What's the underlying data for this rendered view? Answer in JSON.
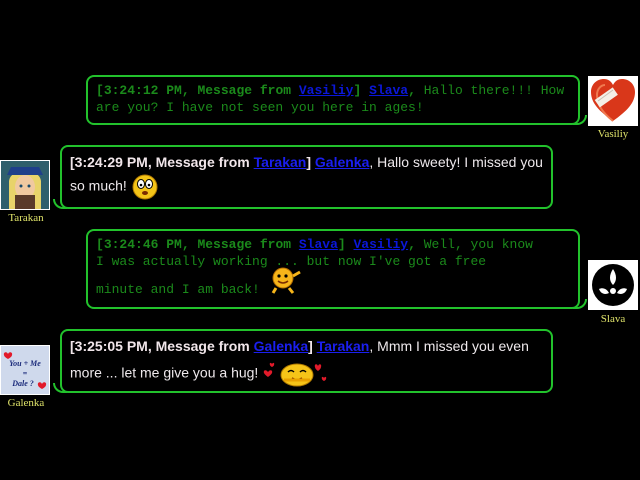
{
  "messages": [
    {
      "time": "3:24:12 PM",
      "prefix": "Message from",
      "from": "Vasiliy",
      "to": "Slava",
      "text": "Hallo there!!! How are you? I have not seen you here in ages!",
      "avatar_name": "Vasiliy"
    },
    {
      "time": "3:24:29 PM",
      "prefix": "Message from",
      "from": "Tarakan",
      "to": "Galenka",
      "text_line1": "Hallo sweety! I missed you",
      "text_line2": "so much!",
      "avatar_name": "Tarakan"
    },
    {
      "time": "3:24:46 PM",
      "prefix": "Message from",
      "from": "Slava",
      "to": "Vasiliy",
      "text_line1": "Well, you know",
      "text_line2": "I was actually working ... but now I've got a free",
      "text_line3": "minute and I am back!",
      "avatar_name": "Slava"
    },
    {
      "time": "3:25:05 PM",
      "prefix": "Message from",
      "from": "Galenka",
      "to": "Tarakan",
      "text_line1": "Mmm I missed you even",
      "text_line2": "more ... let me give you a hug!",
      "avatar_name": "Galenka",
      "avatar_text_line1": "You + Me",
      "avatar_text_line2": "=",
      "avatar_text_line3": "Dale ?"
    }
  ]
}
